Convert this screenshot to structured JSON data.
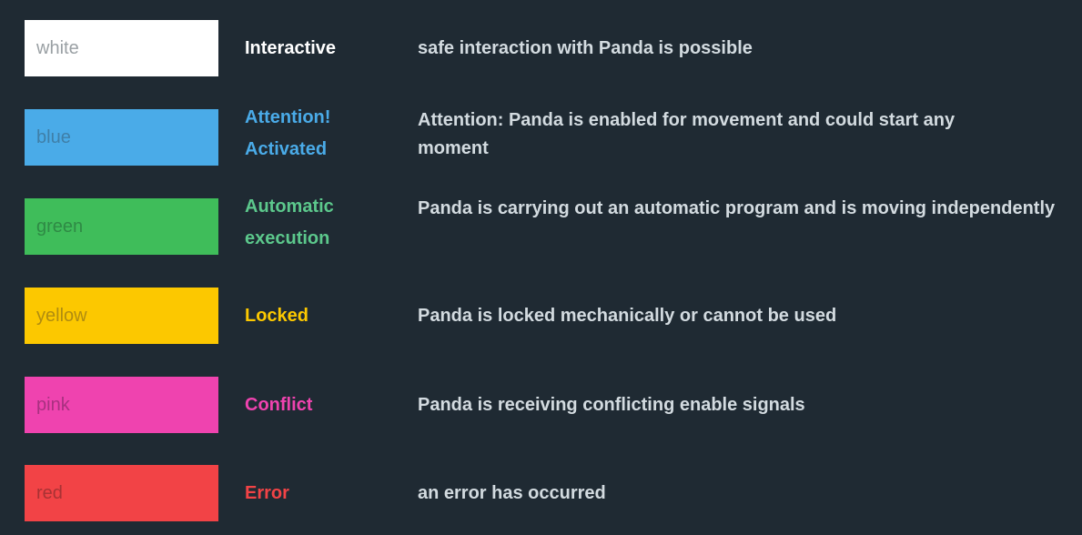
{
  "rows": [
    {
      "swatch_label": "white",
      "swatch_color": "#ffffff",
      "swatch_text_color": "#9aa0a4",
      "state_label": "Interactive",
      "state_color": "#ffffff",
      "description": "safe interaction with Panda is possible"
    },
    {
      "swatch_label": "blue",
      "swatch_color": "#4aabe8",
      "swatch_text_color": "#3f7fa8",
      "state_label": "Attention! Activated",
      "state_color": "#4aabe8",
      "description": "Attention: Panda is enabled for movement and could start any moment"
    },
    {
      "swatch_label": "green",
      "swatch_color": "#3fbd5a",
      "swatch_text_color": "#2f8a45",
      "state_label": "Automatic execution",
      "state_color": "#5cc88c",
      "description": "Panda is carrying out an automatic program and is moving independently"
    },
    {
      "swatch_label": "yellow",
      "swatch_color": "#fcc800",
      "swatch_text_color": "#b08c10",
      "state_label": "Locked",
      "state_color": "#fcc800",
      "description": "Panda is locked mechanically or cannot be used"
    },
    {
      "swatch_label": "pink",
      "swatch_color": "#ef43af",
      "swatch_text_color": "#a83180",
      "state_label": "Conflict",
      "state_color": "#ef43af",
      "description": "Panda is receiving conflicting enable signals"
    },
    {
      "swatch_label": "red",
      "swatch_color": "#f24346",
      "swatch_text_color": "#a83234",
      "state_label": "Error",
      "state_color": "#f24346",
      "description": "an error has occurred"
    }
  ]
}
